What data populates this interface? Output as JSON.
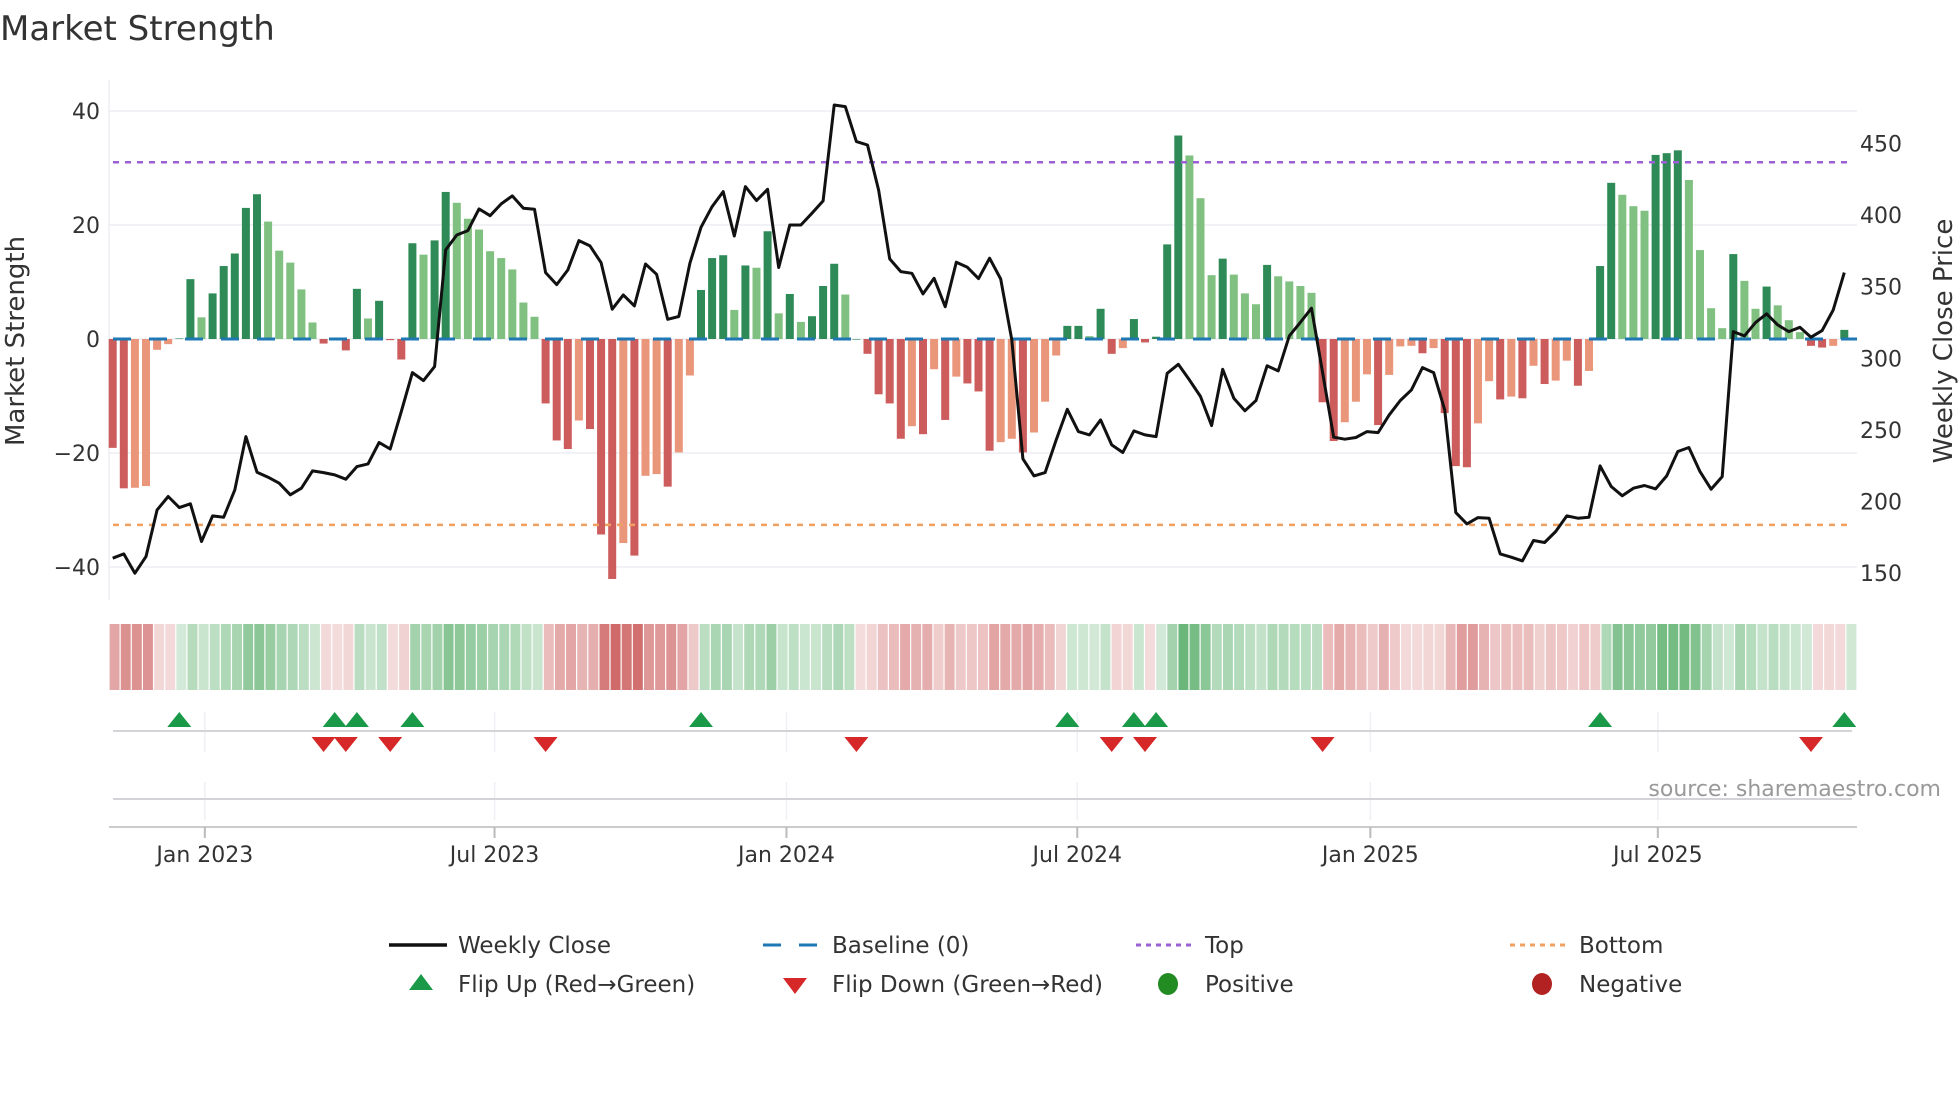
{
  "title": "Market Strength",
  "source": "source: sharemaestro.com",
  "chart_data": {
    "type": "bar",
    "title": "Market Strength",
    "ylabel": "Market Strength",
    "y2label": "Weekly Close Price",
    "ylim": [
      -44,
      44
    ],
    "y2lim": [
      135,
      485
    ],
    "yticks": [
      "40",
      "20",
      "0",
      "−20",
      "−40"
    ],
    "ytick_values": [
      40,
      20,
      0,
      -20,
      -40
    ],
    "y2ticks": [
      "450",
      "400",
      "350",
      "300",
      "250",
      "200",
      "150"
    ],
    "y2tick_values": [
      450,
      400,
      350,
      300,
      250,
      200,
      150
    ],
    "xtick_labels": [
      "Jan 2023",
      "Jul 2023",
      "Jan 2024",
      "Jul 2024",
      "Jan 2025",
      "Jul 2025"
    ],
    "xtick_week_index": [
      8.3,
      34.4,
      60.7,
      86.9,
      113.3,
      139.2
    ],
    "top_level": 31,
    "bottom_level": -32.6,
    "baseline": 0,
    "strength": [
      -19.1,
      -26.2,
      -26.1,
      -25.8,
      -1.9,
      -0.9,
      0.1,
      10.5,
      3.8,
      8.0,
      12.8,
      15.0,
      23.0,
      25.4,
      20.6,
      15.5,
      13.4,
      8.7,
      2.9,
      -0.8,
      0,
      -2.0,
      8.8,
      3.6,
      6.7,
      -0.2,
      -3.6,
      16.8,
      14.8,
      17.3,
      25.8,
      23.9,
      21.1,
      19.2,
      15.4,
      14.2,
      12.2,
      6.4,
      3.9,
      -11.3,
      -17.8,
      -19.3,
      -14.3,
      -15.8,
      -34.3,
      -42.1,
      -35.8,
      -38.0,
      -24.0,
      -23.7,
      -25.9,
      -19.9,
      -6.4,
      8.6,
      14.2,
      14.7,
      5.1,
      12.9,
      12.5,
      18.9,
      4.5,
      7.9,
      3.0,
      4.0,
      9.3,
      13.2,
      7.8,
      0,
      -2.6,
      -9.7,
      -11.3,
      -17.5,
      -15.3,
      -16.7,
      -5.3,
      -14.2,
      -6.6,
      -7.8,
      -9.2,
      -19.6,
      -18.1,
      -17.5,
      -19.9,
      -16.4,
      -11.0,
      -2.9,
      2.3,
      2.3,
      0.5,
      5.3,
      -2.6,
      -1.6,
      3.5,
      -0.6,
      0.4,
      16.6,
      35.7,
      32.2,
      24.7,
      11.2,
      14.1,
      11.3,
      8.0,
      6.1,
      13.0,
      11.0,
      10.1,
      9.3,
      8.1,
      -11.1,
      -17.9,
      -14.6,
      -11.0,
      -6.2,
      -15.1,
      -6.3,
      -1.3,
      -1.2,
      -2.5,
      -1.6,
      -13.0,
      -22.3,
      -22.5,
      -14.8,
      -7.4,
      -10.6,
      -10.1,
      -10.4,
      -4.7,
      -7.9,
      -7.3,
      -3.8,
      -8.2,
      -5.6,
      12.8,
      27.4,
      25.3,
      23.3,
      22.5,
      32.3,
      32.6,
      33.1,
      27.9,
      15.6,
      5.4,
      1.9,
      14.9,
      10.2,
      5.3,
      9.2,
      5.9,
      3.3,
      1.2,
      -1.2,
      -1.5,
      -1.2,
      1.6
    ],
    "weekly_close": [
      160.5,
      163.5,
      150,
      161.6,
      194.2,
      203.5,
      195.8,
      198.4,
      172.1,
      190,
      189.1,
      208.1,
      245.3,
      220.5,
      217,
      212.8,
      204.7,
      209.3,
      221.4,
      220.2,
      218.6,
      215.6,
      224.4,
      226.3,
      241.2,
      236.7,
      262.8,
      290,
      284.4,
      294.2,
      375.6,
      386,
      389.1,
      404.2,
      399.5,
      407.7,
      413.3,
      404.7,
      404,
      359.8,
      351.4,
      361.6,
      382.1,
      378.4,
      366.7,
      334.2,
      344.2,
      336.5,
      365.8,
      358.6,
      327.2,
      329.1,
      366.3,
      391.4,
      405.8,
      416.3,
      385.3,
      419.8,
      410,
      417.9,
      363.3,
      393,
      393,
      401.2,
      409.8,
      476.7,
      475.6,
      451.2,
      448.8,
      417.4,
      369.3,
      360.5,
      359.3,
      344.9,
      355.8,
      336,
      367,
      363.5,
      355.6,
      369.8,
      355.3,
      312.8,
      229.8,
      217.9,
      220.2,
      243,
      264.4,
      248.8,
      246.5,
      257,
      239.5,
      234.2,
      249.3,
      246.5,
      245.3,
      289.5,
      295.8,
      284.9,
      273.3,
      253,
      292.3,
      272.1,
      263.3,
      270.5,
      294.7,
      291.2,
      315.6,
      325.1,
      334.9,
      290,
      244.9,
      243.5,
      244.7,
      248.8,
      248.1,
      260.5,
      270.5,
      277.9,
      293.5,
      290,
      264,
      192.3,
      184.4,
      188.8,
      188.4,
      163.5,
      161.2,
      158.6,
      172.8,
      171.4,
      179.1,
      190,
      188.4,
      189.1,
      224.9,
      210.5,
      204,
      209.3,
      211.2,
      208.8,
      217.9,
      234.9,
      237.7,
      220.9,
      208.6,
      217.4,
      318.6,
      315.6,
      324.9,
      331,
      323.3,
      318.6,
      321.6,
      314.7,
      319.3,
      333.7,
      359.8
    ],
    "flip_up_week_index": [
      6,
      20,
      22,
      27,
      53,
      86,
      92,
      94,
      134,
      156
    ],
    "flip_down_week_index": [
      19,
      21,
      25,
      39,
      67,
      90,
      93,
      109,
      153
    ],
    "legend": [
      {
        "label": "Weekly Close",
        "symbol": "line",
        "color": "#111111"
      },
      {
        "label": "Baseline (0)",
        "symbol": "dash",
        "color": "#1f77b4"
      },
      {
        "label": "Top",
        "symbol": "dot",
        "color": "#9b5fd6"
      },
      {
        "label": "Bottom",
        "symbol": "dot",
        "color": "#f0a060"
      },
      {
        "label": "Flip Up (Red→Green)",
        "symbol": "triangle-up",
        "color": "#1a9a48"
      },
      {
        "label": "Flip Down (Green→Red)",
        "symbol": "triangle-down",
        "color": "#d62828"
      },
      {
        "label": "Positive",
        "symbol": "circle",
        "color": "#228b22"
      },
      {
        "label": "Negative",
        "symbol": "circle",
        "color": "#b22222"
      }
    ],
    "legend_placement": "bottom",
    "colors": {
      "pos_strong": "#2e8b57",
      "pos_weak": "#80c080",
      "neg_strong": "#cd5c5c",
      "neg_weak": "#e9967a"
    }
  }
}
